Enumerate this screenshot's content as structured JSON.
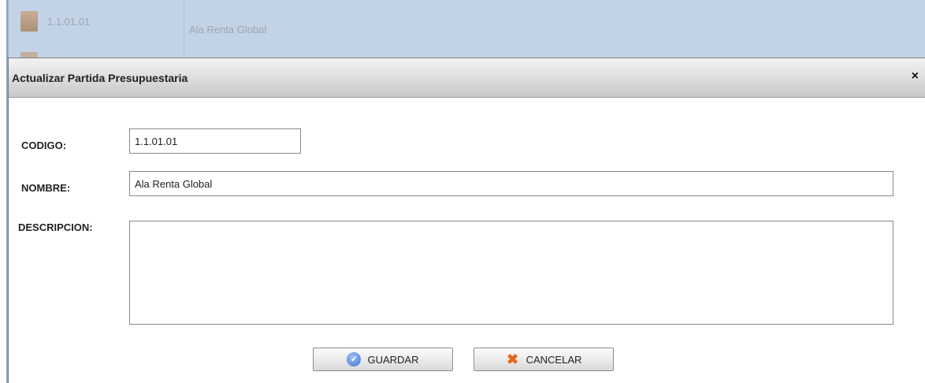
{
  "background_row": {
    "code": "1.1.01.01",
    "name": "Ala Renta Global"
  },
  "dialog": {
    "title": "Actualizar Partida Presupuestaria",
    "close_glyph": "×"
  },
  "form": {
    "codigo_label": "CODIGO:",
    "codigo_value": "1.1.01.01",
    "nombre_label": "NOMBRE:",
    "nombre_value": "Ala Renta Global",
    "descripcion_label": "DESCRIPCION:",
    "descripcion_value": ""
  },
  "buttons": {
    "save_label": "GUARDAR",
    "save_icon": "check-circle-icon",
    "cancel_label": "CANCELAR",
    "cancel_icon": "x-icon"
  },
  "colors": {
    "grid_row": "#c3d3e6",
    "header_gradient_top": "#f2f2f2",
    "header_gradient_bottom": "#c8c8c8",
    "cancel_icon": "#e8661c",
    "save_icon": "#3d6fd1"
  }
}
